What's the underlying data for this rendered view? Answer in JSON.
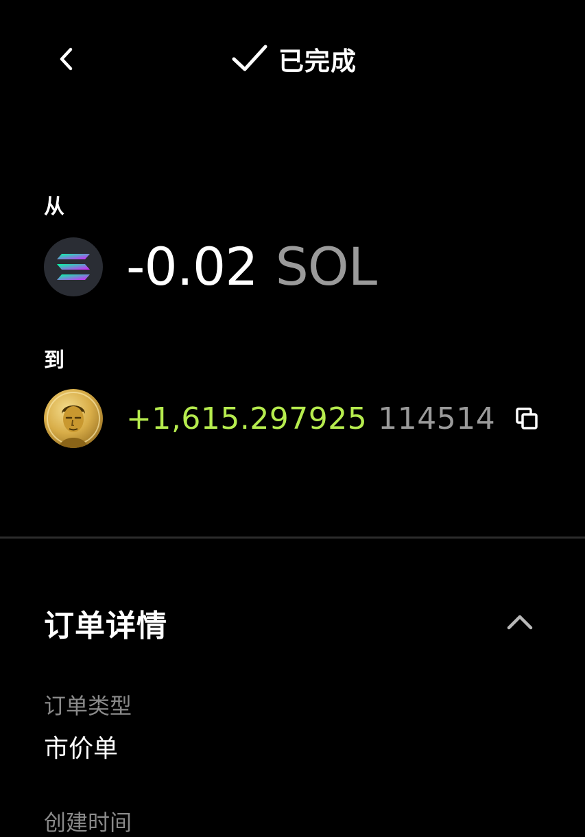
{
  "header": {
    "back_icon": "chevron-left-icon",
    "status_icon": "checkmark-icon",
    "status_text": "已完成"
  },
  "from": {
    "label": "从",
    "token_icon": "solana-logo-icon",
    "amount": "-0.02",
    "symbol": "SOL"
  },
  "to": {
    "label": "到",
    "token_icon": "meme-coin-portrait-icon",
    "amount": "+1,615.297925",
    "symbol": "114514",
    "copy_icon": "copy-icon"
  },
  "details": {
    "title": "订单详情",
    "collapse_icon": "chevron-up-icon",
    "order_type_label": "订单类型",
    "order_type_value": "市价单",
    "created_time_label": "创建时间"
  },
  "colors": {
    "background": "#000000",
    "primary_text": "#ffffff",
    "muted_text": "#9a9a9a",
    "positive": "#b6ec4e",
    "divider": "#2c2c2c"
  }
}
